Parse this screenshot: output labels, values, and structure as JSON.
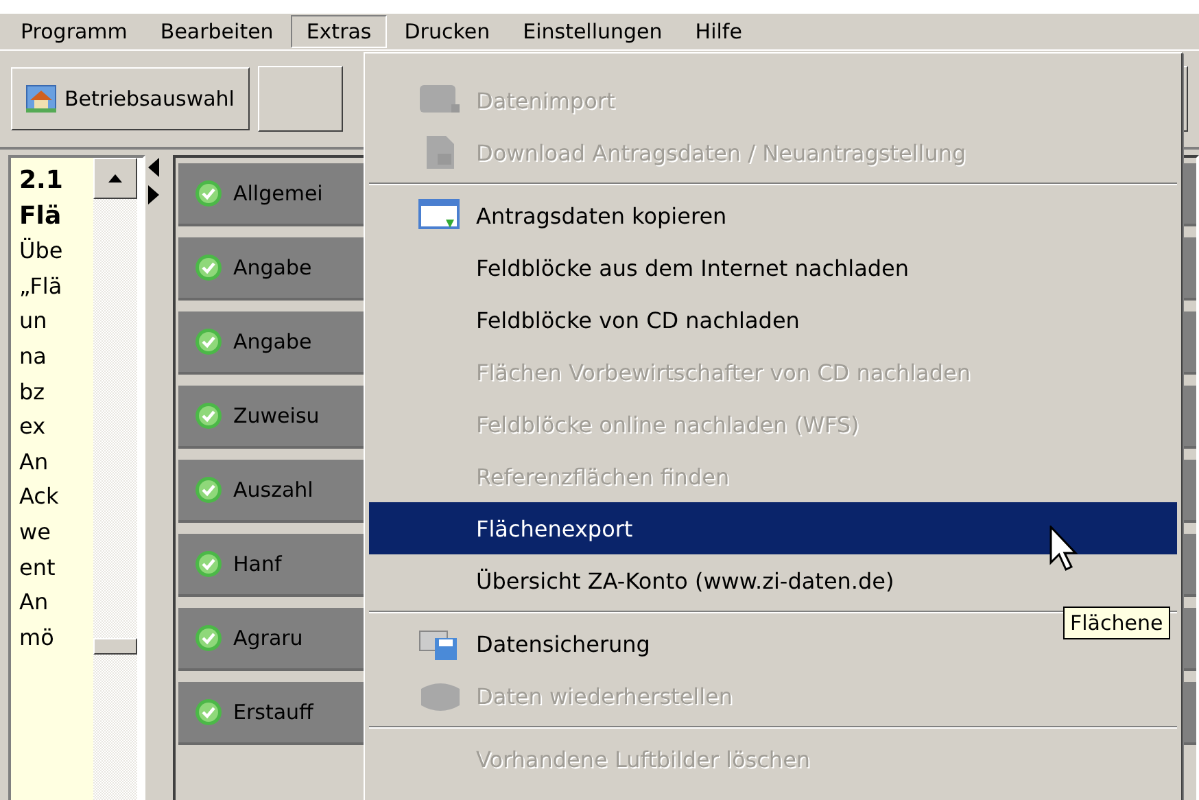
{
  "menubar": [
    {
      "label": "Programm",
      "selected": false
    },
    {
      "label": "Bearbeiten",
      "selected": false
    },
    {
      "label": "Extras",
      "selected": true
    },
    {
      "label": "Drucken",
      "selected": false
    },
    {
      "label": "Einstellungen",
      "selected": false
    },
    {
      "label": "Hilfe",
      "selected": false
    }
  ],
  "toolbar": {
    "button": "Betriebsauswahl"
  },
  "help_panel": {
    "lines": [
      {
        "text": "2.1",
        "bold": true
      },
      {
        "text": "Flä",
        "bold": true
      },
      {
        "text": "Übe",
        "bold": false
      },
      {
        "text": "„Flä",
        "bold": false
      },
      {
        "text": "un",
        "bold": false
      },
      {
        "text": "na",
        "bold": false
      },
      {
        "text": "bz",
        "bold": false
      },
      {
        "text": "ex",
        "bold": false
      },
      {
        "text": "An",
        "bold": false
      },
      {
        "text": "Ack",
        "bold": false
      },
      {
        "text": "we",
        "bold": false
      },
      {
        "text": "ent",
        "bold": false
      },
      {
        "text": "An",
        "bold": false
      },
      {
        "text": "mö",
        "bold": false
      }
    ]
  },
  "sections": [
    "Allgemei",
    "Angabe",
    "Angabe",
    "Zuweisu",
    "Auszahl",
    "Hanf",
    "Agraru",
    "Erstauff"
  ],
  "extras_menu": [
    {
      "kind": "item",
      "label": "Datenimport",
      "disabled": true,
      "selected": false
    },
    {
      "kind": "item",
      "label": "Download Antragsdaten / Neuantragstellung",
      "disabled": true,
      "selected": false
    },
    {
      "kind": "separator"
    },
    {
      "kind": "item",
      "label": "Antragsdaten kopieren",
      "disabled": false,
      "selected": false
    },
    {
      "kind": "item",
      "label": "Feldblöcke aus dem Internet nachladen",
      "disabled": false,
      "selected": false
    },
    {
      "kind": "item",
      "label": "Feldblöcke von CD nachladen",
      "disabled": false,
      "selected": false
    },
    {
      "kind": "item",
      "label": "Flächen Vorbewirtschafter von CD nachladen",
      "disabled": true,
      "selected": false
    },
    {
      "kind": "item",
      "label": "Feldblöcke online nachladen (WFS)",
      "disabled": true,
      "selected": false
    },
    {
      "kind": "item",
      "label": "Referenzflächen finden",
      "disabled": true,
      "selected": false
    },
    {
      "kind": "item",
      "label": "Flächenexport",
      "disabled": false,
      "selected": true
    },
    {
      "kind": "item",
      "label": "Übersicht ZA-Konto (www.zi-daten.de)",
      "disabled": false,
      "selected": false
    },
    {
      "kind": "separator"
    },
    {
      "kind": "item",
      "label": "Datensicherung",
      "disabled": false,
      "selected": false
    },
    {
      "kind": "item",
      "label": "Daten wiederherstellen",
      "disabled": true,
      "selected": false
    },
    {
      "kind": "separator"
    },
    {
      "kind": "item",
      "label": "Vorhandene Luftbilder löschen",
      "disabled": true,
      "selected": false
    }
  ],
  "tooltip": "Flächene"
}
